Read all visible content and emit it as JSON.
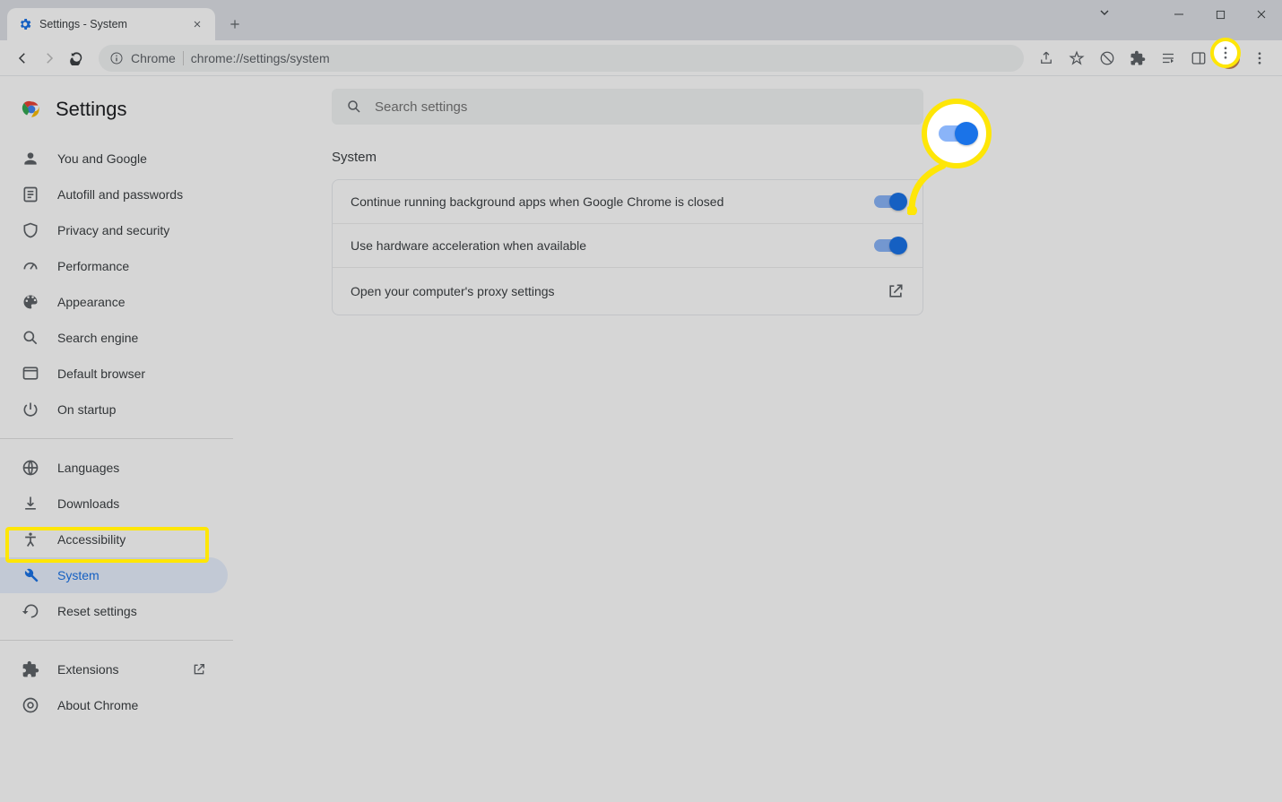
{
  "window": {
    "tab_title": "Settings - System",
    "omnibox": {
      "app": "Chrome",
      "url": "chrome://settings/system"
    }
  },
  "header": {
    "title": "Settings"
  },
  "search": {
    "placeholder": "Search settings"
  },
  "nav": {
    "group1": [
      {
        "label": "You and Google"
      },
      {
        "label": "Autofill and passwords"
      },
      {
        "label": "Privacy and security"
      },
      {
        "label": "Performance"
      },
      {
        "label": "Appearance"
      },
      {
        "label": "Search engine"
      },
      {
        "label": "Default browser"
      },
      {
        "label": "On startup"
      }
    ],
    "group2": [
      {
        "label": "Languages"
      },
      {
        "label": "Downloads"
      },
      {
        "label": "Accessibility"
      },
      {
        "label": "System"
      },
      {
        "label": "Reset settings"
      }
    ],
    "group3": [
      {
        "label": "Extensions"
      },
      {
        "label": "About Chrome"
      }
    ]
  },
  "section": {
    "title": "System"
  },
  "rows": {
    "bg_apps": "Continue running background apps when Google Chrome is closed",
    "hw_accel": "Use hardware acceleration when available",
    "proxy": "Open your computer's proxy settings"
  }
}
